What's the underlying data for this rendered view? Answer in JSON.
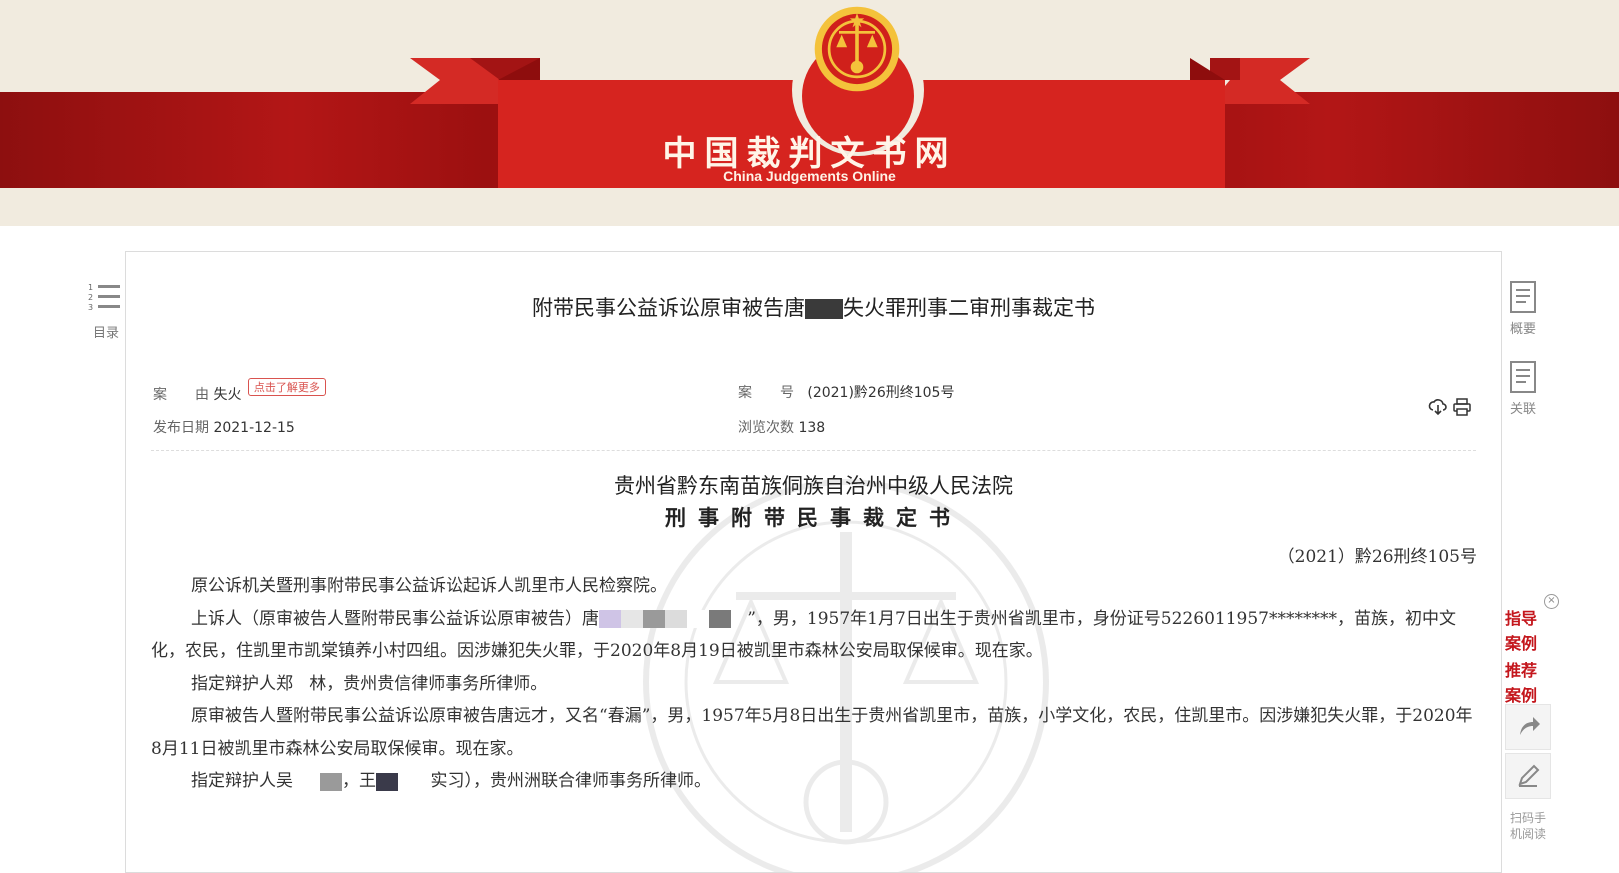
{
  "banner": {
    "title": "中国裁判文书网",
    "subtitle": "China Judgements Online"
  },
  "toc": {
    "label": "目录",
    "numbers": [
      "1",
      "2",
      "3"
    ]
  },
  "right_tools": {
    "summary": "概要",
    "related": "关联",
    "guiding": "指导案例",
    "recommended": "推荐案例",
    "scan": "扫码手机阅读"
  },
  "doc": {
    "title_left": "附带民事公益诉讼原审被告唐",
    "title_right": "失火罪刑事二审刑事裁定书",
    "cause_key": "案　　由",
    "cause_value": "失火",
    "cause_tag": "点击了解更多",
    "caseno_key": "案　　号",
    "caseno_value": "(2021)黔26刑终105号",
    "date_key": "发布日期",
    "date_value": "2021-12-15",
    "views_key": "浏览次数",
    "views_value": "138",
    "court": "贵州省黔东南苗族侗族自治州中级人民法院",
    "doctype": "刑事附带民事裁定书",
    "caseno_right": "（2021）黔26刑终105号",
    "p1": "原公诉机关暨刑事附带民事公益诉讼起诉人凯里市人民检察院。",
    "p2a": "上诉人（原审被告人暨附带民事公益诉讼原审被告）唐",
    "p2b": "”，男，1957年1月7日出生于贵州省凯里市，身份证号5226011957********，苗族，初中文化，农民，住凯里市凯棠镇养小村四组。因涉嫌犯失火罪，于2020年8月19日被凯里市森林公安局取保候审。现在家。",
    "p3a": "指定辩护人郑",
    "p3b": "林，贵州贵信律师事务所律师。",
    "p4": "原审被告人暨附带民事公益诉讼原审被告唐远才，又名“春漏”，男，1957年5月8日出生于贵州省凯里市，苗族，小学文化，农民，住凯里市。因涉嫌犯失火罪，于2020年8月11日被凯里市森林公安局取保候审。现在家。",
    "p5a": "指定辩护人吴",
    "p5b": "，王",
    "p5c": "实习），贵州洲联合律师事务所律师。"
  },
  "colors": {
    "brand_red": "#c4161c",
    "banner_bg": "#f1ebdf"
  }
}
